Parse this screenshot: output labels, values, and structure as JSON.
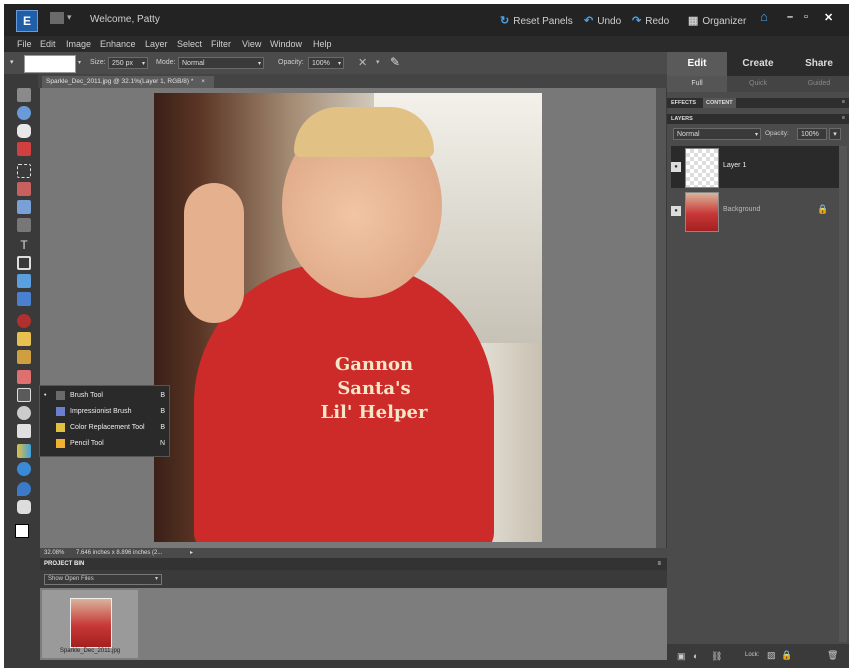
{
  "title_bar": {
    "welcome": "Welcome, Patty",
    "reset_panels": "Reset Panels",
    "undo": "Undo",
    "redo": "Redo",
    "organizer": "Organizer"
  },
  "menu": [
    "File",
    "Edit",
    "Image",
    "Enhance",
    "Layer",
    "Select",
    "Filter",
    "View",
    "Window",
    "Help"
  ],
  "options_bar": {
    "size_label": "Size:",
    "size_value": "250 px",
    "mode_label": "Mode:",
    "mode_value": "Normal",
    "opacity_label": "Opacity:",
    "opacity_value": "100%"
  },
  "document_tab": "Sparkle_Dec_2011.jpg @ 32.1%(Layer 1, RGB/8) *",
  "photo_text": [
    "Gannon",
    "Santa's",
    "Lil' Helper"
  ],
  "flyout": [
    {
      "label": "Brush Tool",
      "key": "B",
      "color": "#3a3a3a"
    },
    {
      "label": "Impressionist Brush",
      "key": "B",
      "color": "#6a7fd0"
    },
    {
      "label": "Color Replacement Tool",
      "key": "B",
      "color": "#e0c040"
    },
    {
      "label": "Pencil Tool",
      "key": "N",
      "color": "#f0b030"
    }
  ],
  "status_bar": {
    "zoom": "32.08%",
    "dimensions": "7.646 inches x 8.896 inches (2..."
  },
  "project_bin": {
    "header": "PROJECT BIN",
    "show": "Show Open Files",
    "item_name": "Sparkle_Dec_2011.jpg"
  },
  "panel": {
    "tabs": [
      "Edit",
      "Create",
      "Share"
    ],
    "subtabs": [
      "Full",
      "Quick",
      "Guided"
    ],
    "group_tabs": [
      "EFFECTS",
      "CONTENT"
    ],
    "layers_header": "LAYERS",
    "blend_mode": "Normal",
    "opacity_label": "Opacity:",
    "opacity_value": "100%",
    "layers": [
      {
        "name": "Layer 1",
        "selected": true
      },
      {
        "name": "Background",
        "selected": false
      }
    ],
    "lock_label": "Lock:"
  },
  "colors": {
    "accent_blue": "#4aa3e8",
    "shirt_red": "#cd2a2a"
  }
}
